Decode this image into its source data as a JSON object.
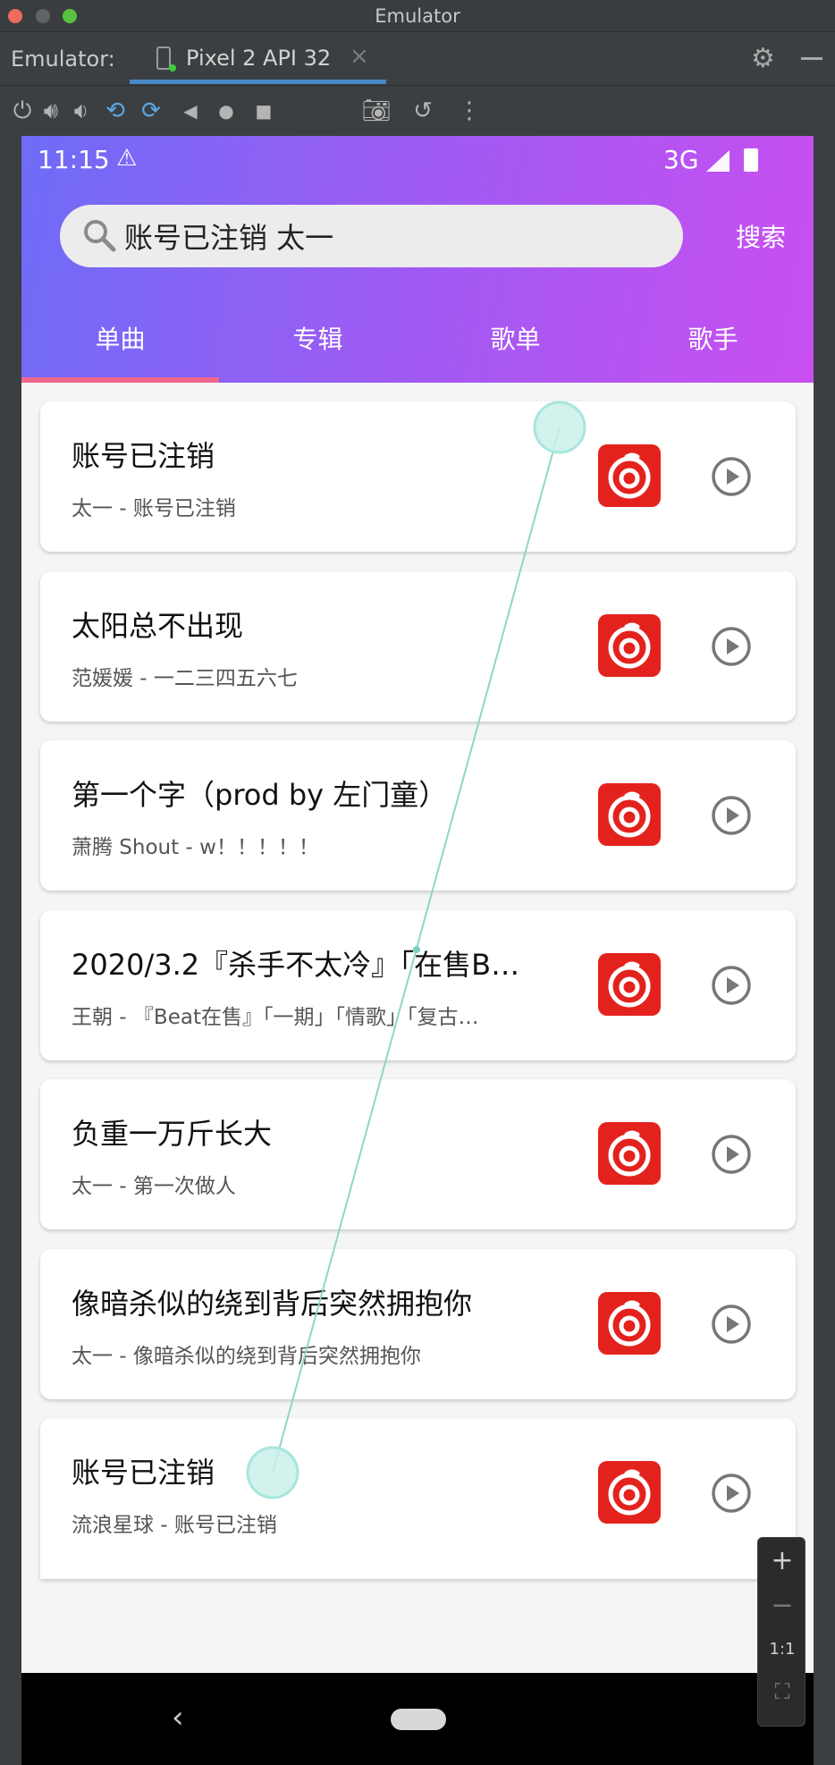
{
  "window": {
    "title": "Emulator"
  },
  "tool_header": {
    "label": "Emulator:",
    "device_tab": "Pixel 2 API 32"
  },
  "status_bar": {
    "time": "11:15",
    "network": "3G"
  },
  "search": {
    "query": "账号已注销 太一",
    "button": "搜索"
  },
  "tabs": [
    {
      "label": "单曲",
      "selected": true
    },
    {
      "label": "专辑",
      "selected": false
    },
    {
      "label": "歌单",
      "selected": false
    },
    {
      "label": "歌手",
      "selected": false
    }
  ],
  "songs": [
    {
      "title": "账号已注销",
      "subtitle": "太一 - 账号已注销"
    },
    {
      "title": "太阳总不出现",
      "subtitle": "范媛媛 - 一二三四五六七"
    },
    {
      "title": "第一个字（prod by 左门童）",
      "subtitle": "萧腾 Shout - w！！！！！"
    },
    {
      "title": "2020/3.2『杀手不太冷』「在售B…",
      "subtitle": "王朝 - 『Beat在售』「一期」「情歌」「复古…"
    },
    {
      "title": "负重一万斤长大",
      "subtitle": "太一 - 第一次做人"
    },
    {
      "title": "像暗杀似的绕到背后突然拥抱你",
      "subtitle": "太一 - 像暗杀似的绕到背后突然拥抱你"
    },
    {
      "title": "账号已注销",
      "subtitle": "流浪星球 - 账号已注销"
    }
  ],
  "zoom": {
    "plus": "+",
    "minus": "−",
    "one_to_one": "1:1"
  },
  "colors": {
    "accent_start": "#6e6cf7",
    "accent_end": "#c94ff0",
    "tab_indicator": "#f0668c",
    "logo_red": "#e4221d"
  }
}
